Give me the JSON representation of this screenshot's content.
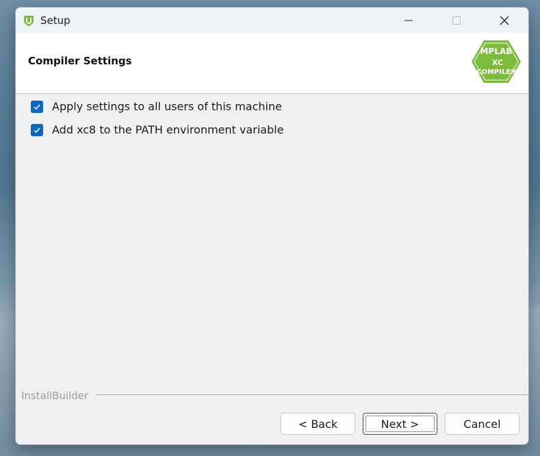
{
  "window": {
    "title": "Setup",
    "icon": "installbuilder-shield-icon"
  },
  "titlebar": {
    "minimize_icon": "minimize-icon",
    "maximize_icon": "maximize-icon",
    "close_icon": "close-icon"
  },
  "header": {
    "title": "Compiler Settings",
    "logo": {
      "name": "mplab-xc-compiler-logo",
      "line1": "MPLAB",
      "line2": "XC",
      "line3": "COMPILER",
      "color": "#7dbb3c"
    }
  },
  "options": [
    {
      "label": "Apply settings to all users of this machine",
      "checked": true
    },
    {
      "label": "Add xc8 to the PATH environment variable",
      "checked": true
    }
  ],
  "footer": {
    "brand": "InstallBuilder",
    "back_label": "< Back",
    "next_label": "Next >",
    "cancel_label": "Cancel"
  },
  "colors": {
    "accent": "#0b67c2",
    "logo_green": "#7dbb3c"
  }
}
